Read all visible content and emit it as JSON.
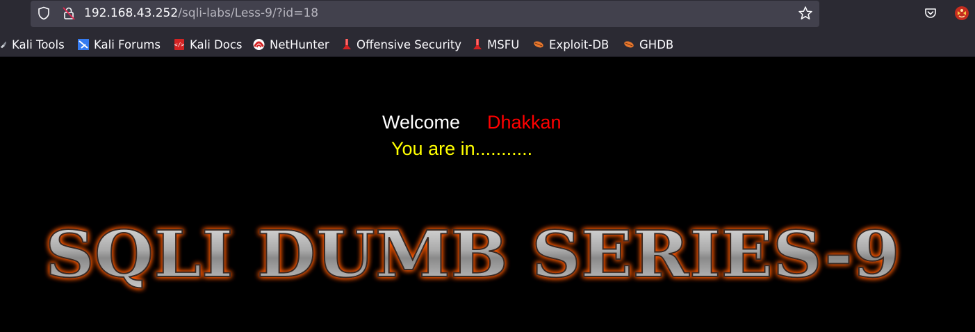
{
  "browser": {
    "url": {
      "host": "192.168.43.252",
      "path": "/sqli-labs/Less-9/?id=18"
    },
    "icons": {
      "tracking_protection": "shield-icon",
      "insecure_connection": "lock-strikethrough-icon",
      "bookmark_page": "star-icon",
      "pocket": "pocket-icon",
      "extension": "extension-icon"
    },
    "bookmarks": [
      {
        "label": "Kali Tools",
        "icon": "kali-dragon-icon"
      },
      {
        "label": "Kali Forums",
        "icon": "kali-forums-icon"
      },
      {
        "label": "Kali Docs",
        "icon": "kali-docs-icon"
      },
      {
        "label": "NetHunter",
        "icon": "nethunter-icon"
      },
      {
        "label": "Offensive Security",
        "icon": "offsec-icon"
      },
      {
        "label": "MSFU",
        "icon": "msfu-icon"
      },
      {
        "label": "Exploit-DB",
        "icon": "exploit-db-icon"
      },
      {
        "label": "GHDB",
        "icon": "ghdb-icon"
      }
    ]
  },
  "page": {
    "welcome_label": "Welcome",
    "username": "Dhakkan",
    "status_message": "You are in...........",
    "banner_text": "SQLI DUMB SERIES-9"
  },
  "colors": {
    "background": "#000000",
    "welcome": "#ffffff",
    "username": "#ff0000",
    "status": "#ffff00",
    "banner_glow": "#ff5a00",
    "chrome_bg": "#2b2a33",
    "urlbar_bg": "#42414d"
  }
}
